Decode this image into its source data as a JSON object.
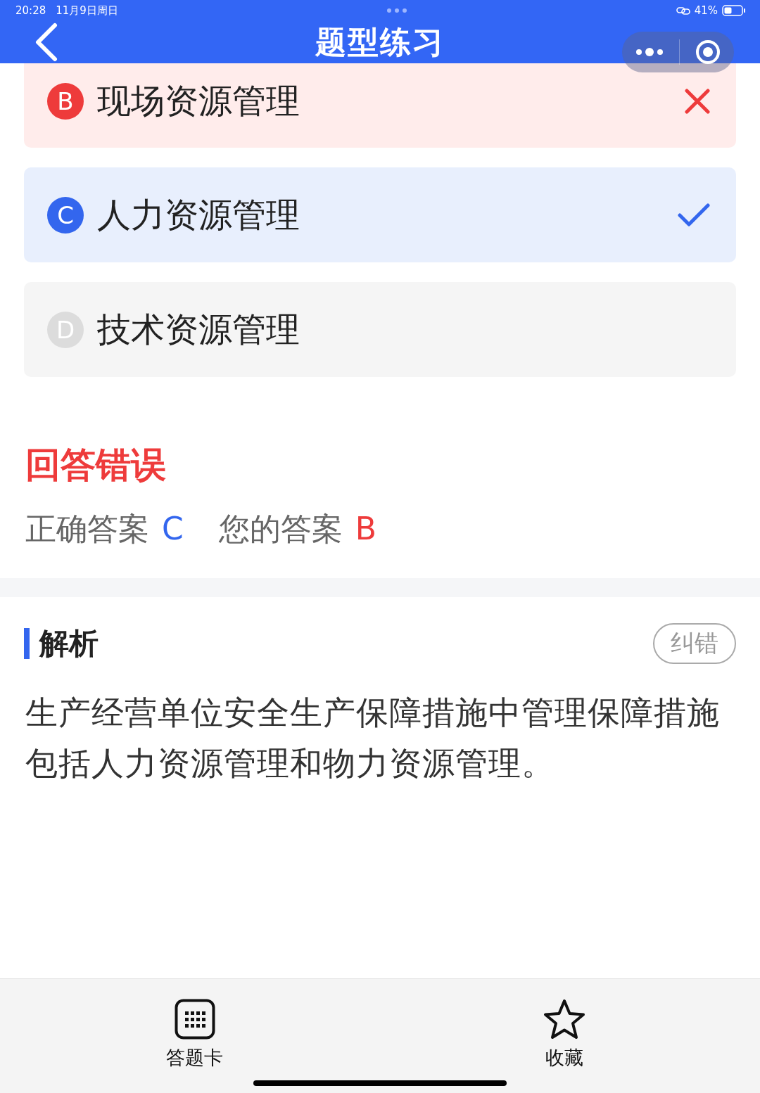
{
  "status_bar": {
    "time": "20:28",
    "date": "11月9日周日",
    "battery": "41%"
  },
  "nav": {
    "title": "题型练习"
  },
  "options": [
    {
      "letter": "B",
      "text": "现场资源管理",
      "kind": "wrong"
    },
    {
      "letter": "C",
      "text": "人力资源管理",
      "kind": "correct"
    },
    {
      "letter": "D",
      "text": "技术资源管理",
      "kind": "neutral"
    }
  ],
  "result": {
    "heading": "回答错误",
    "correct_label": "正确答案",
    "correct": "C",
    "yours_label": "您的答案",
    "yours": "B"
  },
  "analysis": {
    "heading": "解析",
    "button": "纠错",
    "text": "生产经营单位安全生产保障措施中管理保障措施包括人力资源管理和物力资源管理。"
  },
  "toolbar": [
    {
      "label": "答题卡",
      "kind": "card"
    },
    {
      "label": "收藏",
      "kind": "star"
    }
  ]
}
